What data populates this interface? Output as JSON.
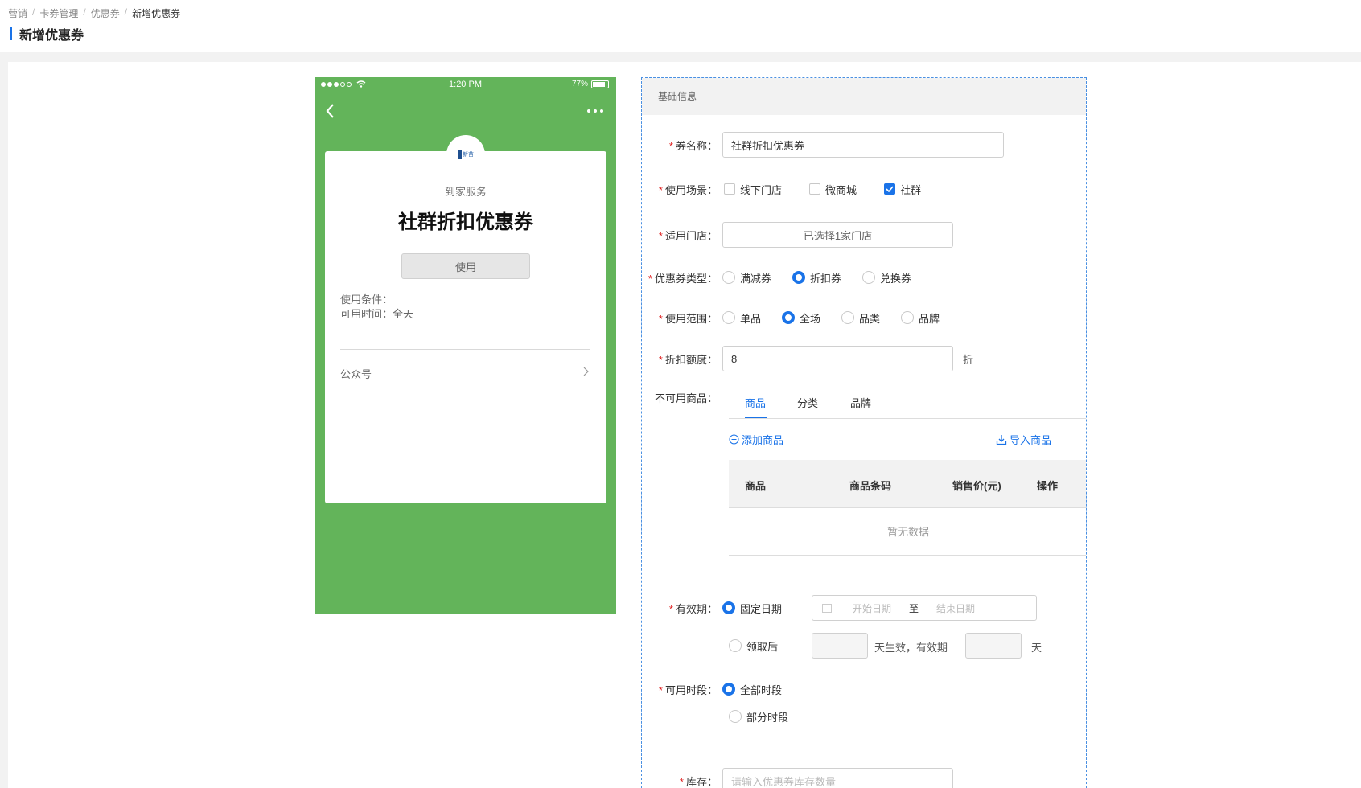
{
  "breadcrumb": [
    "营销",
    "卡券管理",
    "优惠券",
    "新增优惠券"
  ],
  "page_title": "新增优惠券",
  "preview": {
    "status_time": "1:20 PM",
    "battery": "77%",
    "merchant": "到家服务",
    "logo_text": "新苗",
    "coupon_name": "社群折扣优惠券",
    "use_button": "使用",
    "conditions": "使用条件：",
    "available_time": "可用时间：全天",
    "official_account": "公众号"
  },
  "form": {
    "section_title": "基础信息",
    "name": {
      "label": "券名称：",
      "value": "社群折扣优惠券"
    },
    "scene": {
      "label": "使用场景：",
      "options": [
        {
          "text": "线下门店",
          "checked": false
        },
        {
          "text": "微商城",
          "checked": false
        },
        {
          "text": "社群",
          "checked": true
        }
      ]
    },
    "store": {
      "label": "适用门店：",
      "value": "已选择1家门店"
    },
    "type": {
      "label": "优惠券类型：",
      "options": [
        {
          "text": "满减券",
          "checked": false
        },
        {
          "text": "折扣券",
          "checked": true
        },
        {
          "text": "兑换券",
          "checked": false
        }
      ]
    },
    "scope": {
      "label": "使用范围：",
      "options": [
        {
          "text": "单品",
          "checked": false
        },
        {
          "text": "全场",
          "checked": true
        },
        {
          "text": "品类",
          "checked": false
        },
        {
          "text": "品牌",
          "checked": false
        }
      ]
    },
    "discount": {
      "label": "折扣额度：",
      "value": "8",
      "unit": "折"
    },
    "excluded": {
      "label": "不可用商品：",
      "tabs": [
        "商品",
        "分类",
        "品牌"
      ],
      "add_link": "添加商品",
      "import_link": "导入商品",
      "columns": [
        "商品",
        "商品条码",
        "销售价(元)",
        "操作"
      ],
      "empty_text": "暂无数据"
    },
    "validity": {
      "label": "有效期：",
      "fixed_label": "固定日期",
      "start_placeholder": "开始日期",
      "to_text": "至",
      "end_placeholder": "结束日期",
      "after_label": "领取后",
      "effective_text": "天生效，有效期",
      "day_unit": "天"
    },
    "period": {
      "label": "可用时段：",
      "options": [
        {
          "text": "全部时段",
          "checked": true
        },
        {
          "text": "部分时段",
          "checked": false
        }
      ]
    },
    "stock": {
      "label": "库存：",
      "placeholder": "请输入优惠券库存数量"
    }
  }
}
